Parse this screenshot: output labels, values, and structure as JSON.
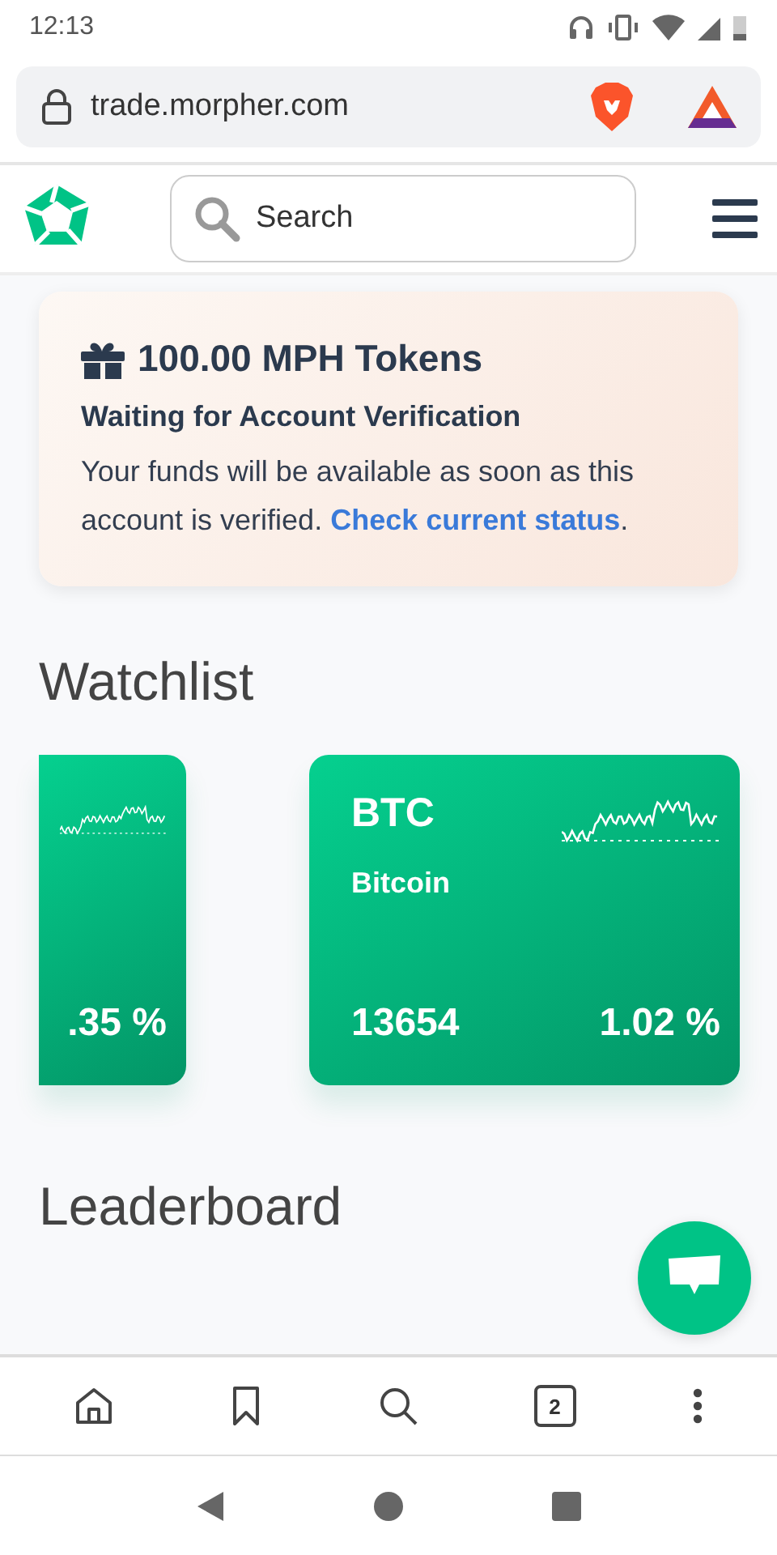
{
  "status_bar": {
    "time": "12:13"
  },
  "browser": {
    "url": "trade.morpher.com",
    "tab_count": "2"
  },
  "header": {
    "search": {
      "placeholder": "Search"
    }
  },
  "promo": {
    "title": "100.00 MPH Tokens",
    "subtitle": "Waiting for Account Verification",
    "body": "Your funds will be available as soon as this account is verified. ",
    "link": "Check current status",
    "end": "."
  },
  "watchlist": {
    "title": "Watchlist",
    "items": [
      {
        "change": ".35 %"
      },
      {
        "symbol": "BTC",
        "name": "Bitcoin",
        "price": "13654",
        "change": "1.02 %"
      }
    ]
  },
  "leaderboard": {
    "title": "Leaderboard"
  }
}
